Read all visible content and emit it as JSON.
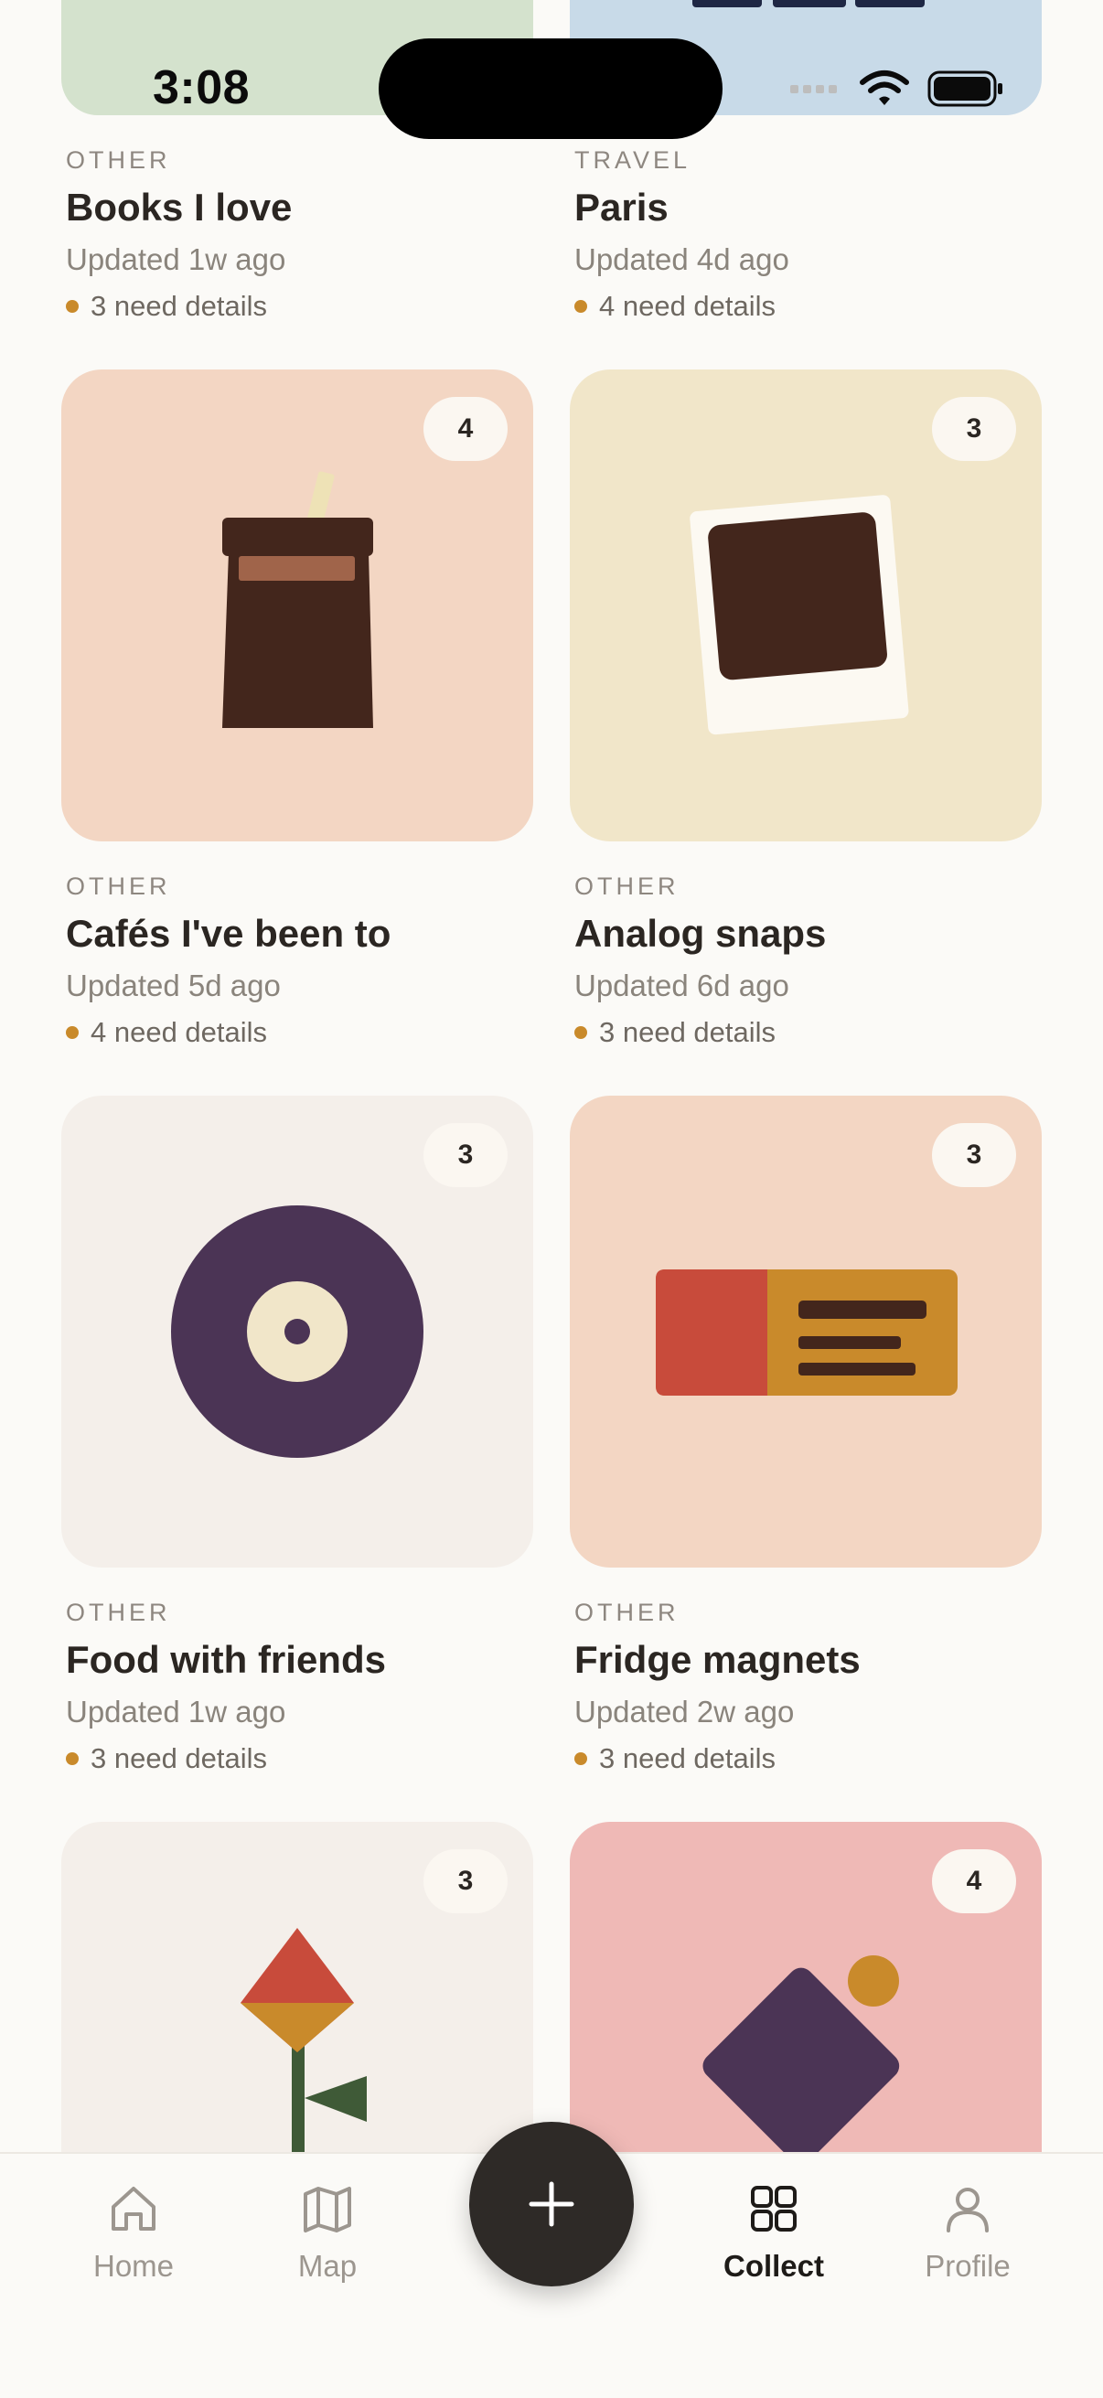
{
  "status": {
    "time": "3:08"
  },
  "cards": [
    {
      "category": "OTHER",
      "title": "Books I love",
      "updated": "Updated 1w ago",
      "needs": "3 need details"
    },
    {
      "category": "TRAVEL",
      "title": "Paris",
      "updated": "Updated 4d ago",
      "needs": "4 need details"
    },
    {
      "category": "OTHER",
      "title": "Cafés I've been to",
      "updated": "Updated 5d ago",
      "needs": "4 need details",
      "count": "4"
    },
    {
      "category": "OTHER",
      "title": "Analog snaps",
      "updated": "Updated 6d ago",
      "needs": "3 need details",
      "count": "3"
    },
    {
      "category": "OTHER",
      "title": "Food with friends",
      "updated": "Updated 1w ago",
      "needs": "3 need details",
      "count": "3"
    },
    {
      "category": "OTHER",
      "title": "Fridge magnets",
      "updated": "Updated 2w ago",
      "needs": "3 need details",
      "count": "3"
    },
    {
      "count": "3"
    },
    {
      "count": "4"
    }
  ],
  "tabs": [
    {
      "label": "Home",
      "icon": "home-icon"
    },
    {
      "label": "Map",
      "icon": "map-icon"
    },
    {
      "label": "Collect",
      "icon": "grid-icon",
      "active": true
    },
    {
      "label": "Profile",
      "icon": "person-icon"
    }
  ],
  "fab": {
    "icon": "plus-icon"
  },
  "colors": {
    "background": "#FBFAF7",
    "accent_dot": "#C98A2B",
    "peach": "#F3D6C3",
    "cream": "#F1E6C9",
    "offwhite": "#F4EFEA",
    "pink": "#EFB9B6",
    "sage": "#D4E2CD",
    "sky": "#C8DAE8"
  }
}
